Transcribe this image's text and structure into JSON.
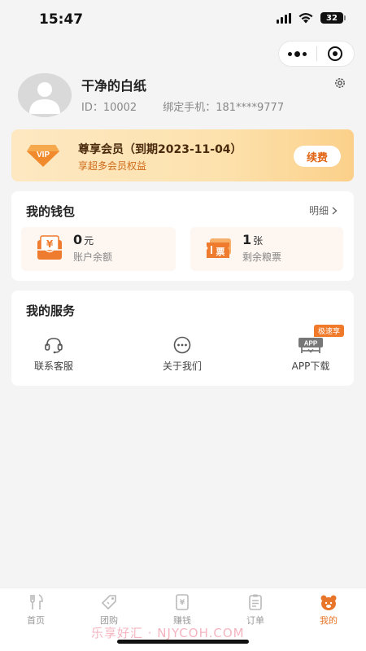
{
  "status_bar": {
    "time": "15:47",
    "battery": "32"
  },
  "profile": {
    "name": "干净的白纸",
    "id_text": "ID：10002",
    "phone_text": "绑定手机：181****9777"
  },
  "vip": {
    "badge": "VIP",
    "title": "尊享会员（到期2023-11-04）",
    "subtitle": "享超多会员权益",
    "renew_label": "续费"
  },
  "wallet": {
    "title": "我的钱包",
    "detail_label": "明细",
    "balance": {
      "value": "0",
      "unit": "元",
      "label": "账户余额"
    },
    "tickets": {
      "value": "1",
      "unit": "张",
      "label": "剩余粮票",
      "icon_text": "票"
    }
  },
  "services": {
    "title": "我的服务",
    "items": [
      {
        "label": "联系客服",
        "icon": "headset-icon"
      },
      {
        "label": "关于我们",
        "icon": "chat-dots-icon"
      },
      {
        "label": "APP下载",
        "icon": "app-download-icon",
        "tag": "极速享"
      }
    ]
  },
  "tab_bar": {
    "items": [
      {
        "label": "首页",
        "icon": "fork-knife-icon",
        "active": false
      },
      {
        "label": "团购",
        "icon": "tag-icon",
        "active": false
      },
      {
        "label": "赚钱",
        "icon": "money-book-icon",
        "active": false
      },
      {
        "label": "订单",
        "icon": "clipboard-icon",
        "active": false
      },
      {
        "label": "我的",
        "icon": "bear-face-icon",
        "active": true
      }
    ]
  },
  "watermark": "乐享好汇 · NJYCOH.COM",
  "colors": {
    "accent": "#e8762a",
    "background": "#f4f4f5",
    "vip_gradient_start": "#fde8c2",
    "vip_gradient_end": "#fbd08a"
  }
}
